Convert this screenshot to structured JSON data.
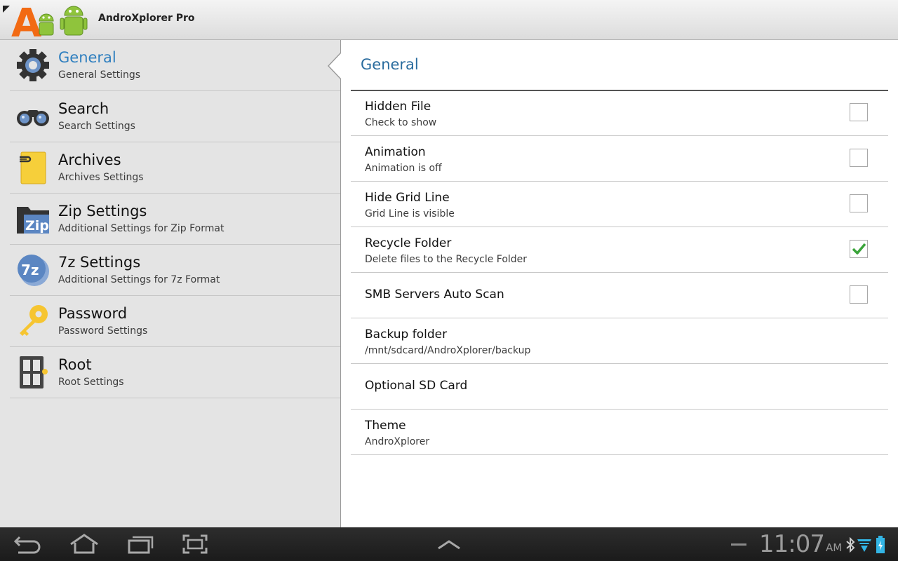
{
  "app": {
    "title": "AndroXplorer Pro",
    "logo_letter": "A"
  },
  "sidebar": {
    "items": [
      {
        "title": "General",
        "subtitle": "General Settings",
        "icon": "gear-icon",
        "selected": true
      },
      {
        "title": "Search",
        "subtitle": "Search Settings",
        "icon": "binoculars-icon"
      },
      {
        "title": "Archives",
        "subtitle": "Archives Settings",
        "icon": "archive-note-icon"
      },
      {
        "title": "Zip Settings",
        "subtitle": "Additional Settings for Zip Format",
        "icon": "zip-folder-icon",
        "icon_text": "Zip"
      },
      {
        "title": "7z Settings",
        "subtitle": "Additional Settings for 7z Format",
        "icon": "7z-icon",
        "icon_text": "7z"
      },
      {
        "title": "Password",
        "subtitle": "Password Settings",
        "icon": "key-icon"
      },
      {
        "title": "Root",
        "subtitle": "Root Settings",
        "icon": "root-icon"
      }
    ]
  },
  "main": {
    "section_title": "General",
    "prefs": [
      {
        "title": "Hidden File",
        "subtitle": "Check to show",
        "checkbox": true,
        "checked": false
      },
      {
        "title": "Animation",
        "subtitle": "Animation is off",
        "checkbox": true,
        "checked": false
      },
      {
        "title": "Hide Grid Line",
        "subtitle": "Grid Line is visible",
        "checkbox": true,
        "checked": false
      },
      {
        "title": "Recycle Folder",
        "subtitle": "Delete files to the Recycle Folder",
        "checkbox": true,
        "checked": true
      },
      {
        "title": "SMB Servers Auto Scan",
        "checkbox": true,
        "checked": false
      },
      {
        "title": "Backup folder",
        "subtitle": "/mnt/sdcard/AndroXplorer/backup"
      },
      {
        "title": "Optional SD Card"
      },
      {
        "title": "Theme",
        "subtitle": "AndroXplorer"
      }
    ]
  },
  "system_bar": {
    "time": "11:07",
    "ampm": "AM",
    "nav_icons": [
      "back-icon",
      "home-icon",
      "recent-apps-icon",
      "screenshot-icon",
      "up-arrow-icon"
    ],
    "status_icons": [
      "bluetooth-icon",
      "wifi-icon",
      "battery-icon"
    ]
  },
  "colors": {
    "accent": "#2f7fbf",
    "section_title": "#2a6c9e",
    "check": "#3aa43a",
    "sidebar_bg": "#e4e4e4"
  }
}
